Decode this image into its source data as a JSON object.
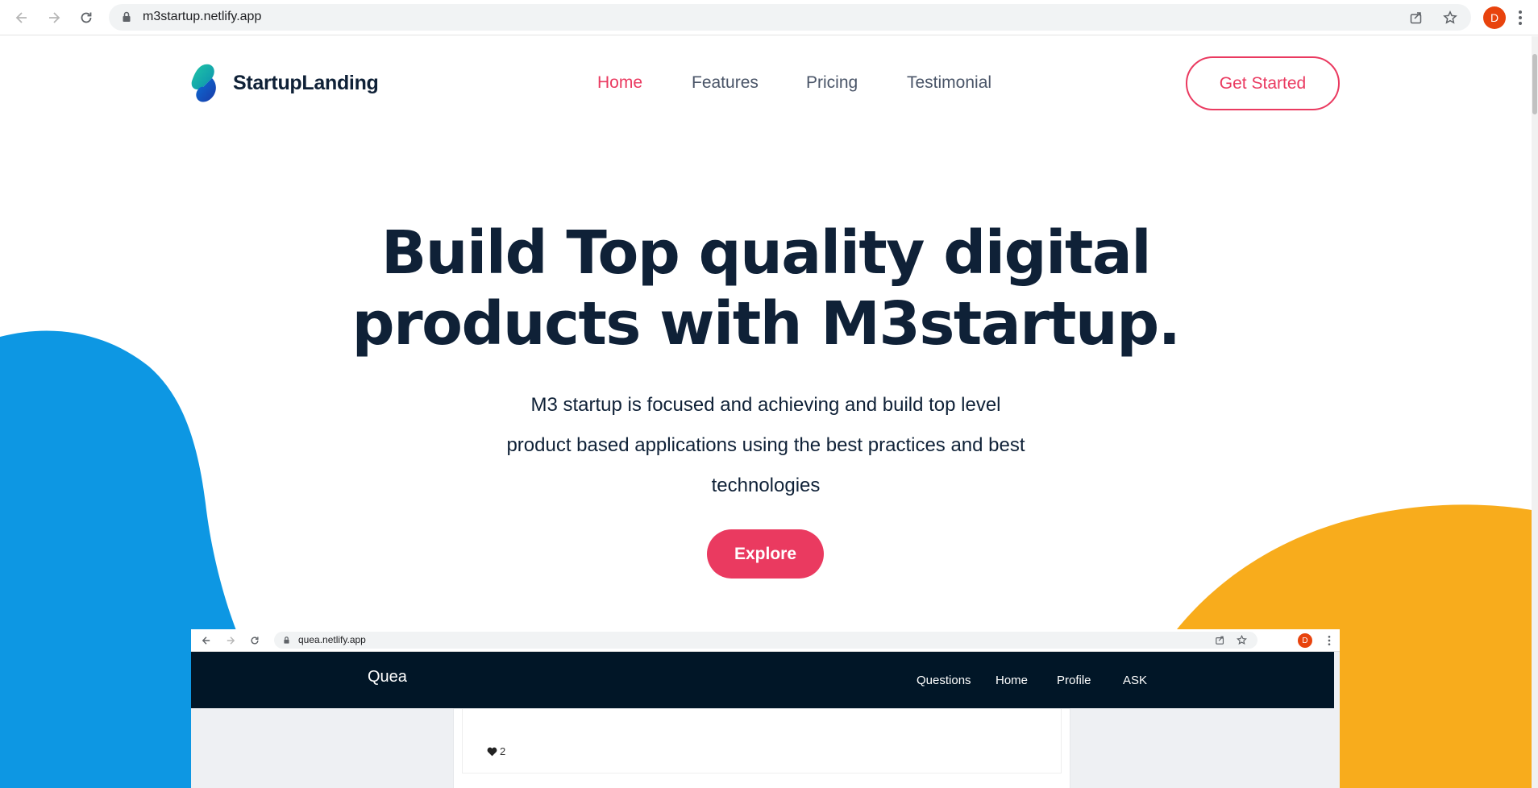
{
  "browser": {
    "url": "m3startup.netlify.app",
    "profile_initial": "D"
  },
  "site": {
    "brand": "StartupLanding",
    "nav": [
      {
        "label": "Home",
        "active": true
      },
      {
        "label": "Features",
        "active": false
      },
      {
        "label": "Pricing",
        "active": false
      },
      {
        "label": "Testimonial",
        "active": false
      }
    ],
    "cta_label": "Get Started",
    "hero": {
      "title_line1": "Build Top quality digital",
      "title_line2": "products with M3startup.",
      "subtitle_line1": "M3 startup is focused and achieving and build top level",
      "subtitle_line2": "product based applications using the best practices and best",
      "subtitle_line3": "technologies",
      "button_label": "Explore"
    },
    "colors": {
      "accent": "#ea3a60",
      "heading": "#0f2137",
      "blob_blue": "#0d97e3",
      "blob_yellow": "#f8ac1c"
    }
  },
  "preview": {
    "url": "quea.netlify.app",
    "profile_initial": "D",
    "brand": "Quea",
    "links": [
      "Questions",
      "Home",
      "Profile",
      "ASK"
    ],
    "like_count": "2"
  }
}
